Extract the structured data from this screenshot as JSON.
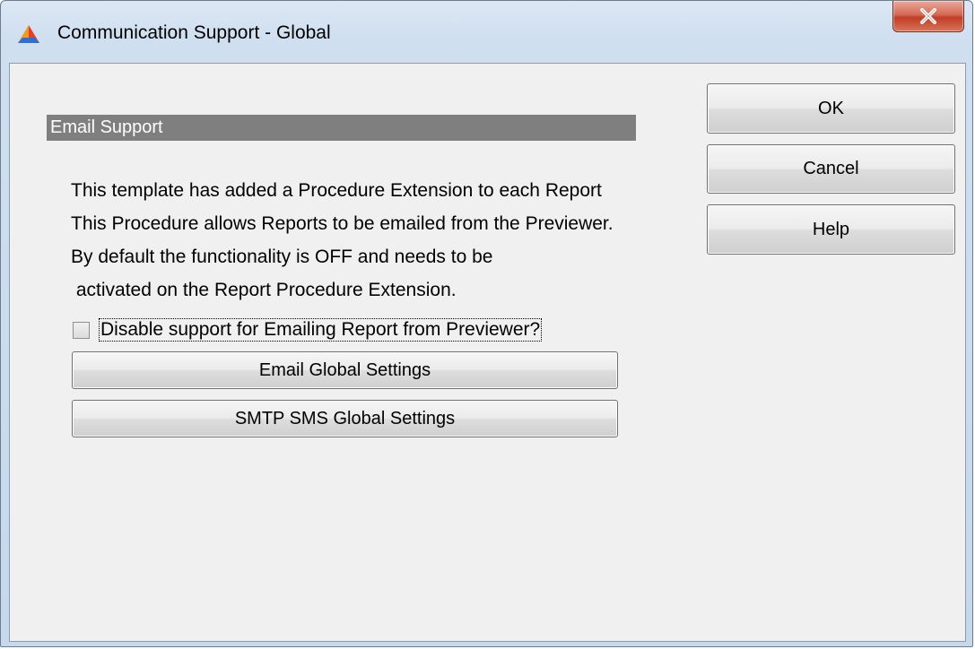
{
  "window": {
    "title": "Communication Support - Global"
  },
  "section": {
    "header": "Email Support"
  },
  "info_lines": [
    "This template has added a Procedure Extension to each Report",
    "This Procedure allows Reports to be emailed from the Previewer.",
    "By default the functionality is OFF and needs to be",
    " activated on the Report Procedure Extension."
  ],
  "checkbox": {
    "label": "Disable support for Emailing Report from Previewer?",
    "checked": false
  },
  "buttons": {
    "email_global": "Email Global Settings",
    "smtp_sms_global": "SMTP SMS Global Settings",
    "ok": "OK",
    "cancel": "Cancel",
    "help": "Help"
  }
}
